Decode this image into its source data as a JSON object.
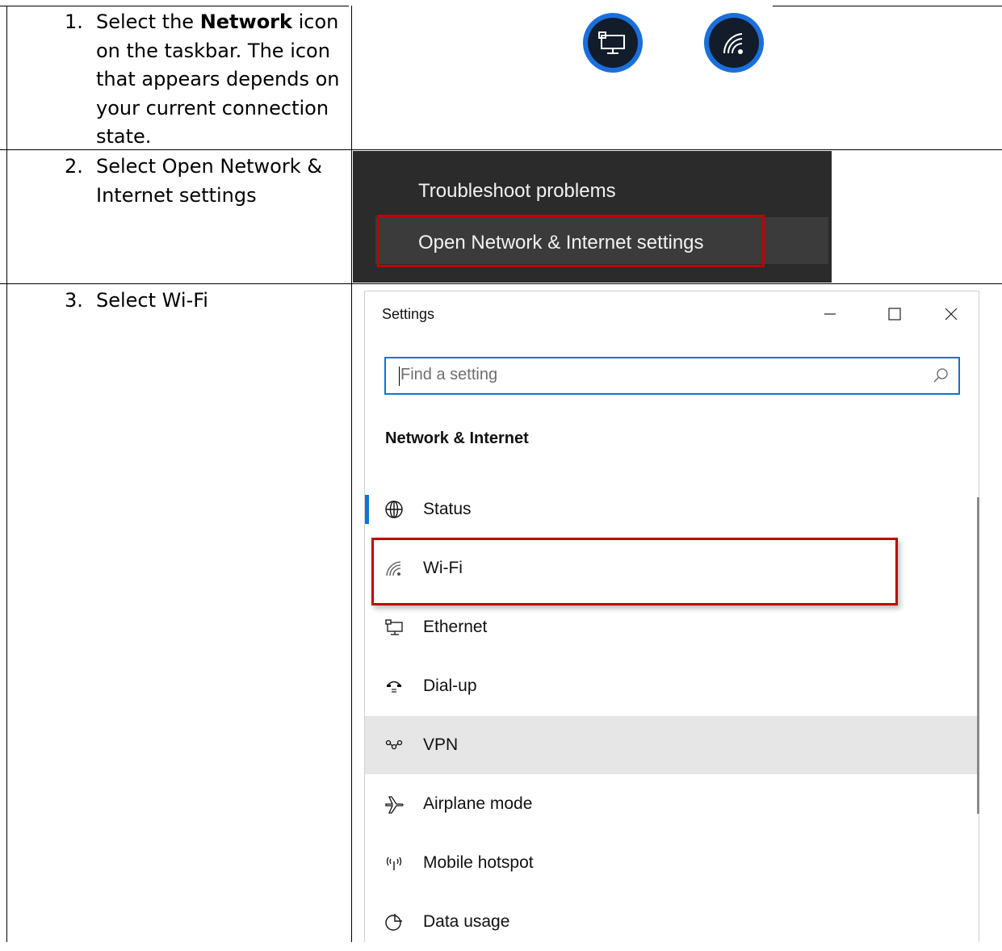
{
  "steps": [
    {
      "number": "1.",
      "text_before": "Select the ",
      "text_bold": "Network",
      "text_after": " icon on the taskbar. The icon that appears depends on your current connection state."
    },
    {
      "number": "2.",
      "text": "Select Open Network & Internet settings"
    },
    {
      "number": "3.",
      "text": "Select Wi-Fi"
    }
  ],
  "taskbar_icons": [
    "ethernet-icon",
    "wifi-icon"
  ],
  "context_menu": {
    "items": [
      "Troubleshoot problems",
      "Open Network & Internet settings"
    ],
    "highlighted_index": 1
  },
  "settings": {
    "window_title": "Settings",
    "search_placeholder": "Find a setting",
    "section_title": "Network & Internet",
    "nav": [
      {
        "label": "Status",
        "icon": "globe-icon"
      },
      {
        "label": "Wi-Fi",
        "icon": "wifi-icon"
      },
      {
        "label": "Ethernet",
        "icon": "ethernet-icon"
      },
      {
        "label": "Dial-up",
        "icon": "dialup-icon"
      },
      {
        "label": "VPN",
        "icon": "vpn-icon"
      },
      {
        "label": "Airplane mode",
        "icon": "airplane-icon"
      },
      {
        "label": "Mobile hotspot",
        "icon": "hotspot-icon"
      },
      {
        "label": "Data usage",
        "icon": "data-usage-icon"
      }
    ],
    "active_item": "Status",
    "hovered_item": "VPN",
    "highlighted_item": "Wi-Fi"
  },
  "colors": {
    "accent": "#0b74d6",
    "highlight_red": "#c00000",
    "menu_bg": "#2b2b2b"
  }
}
